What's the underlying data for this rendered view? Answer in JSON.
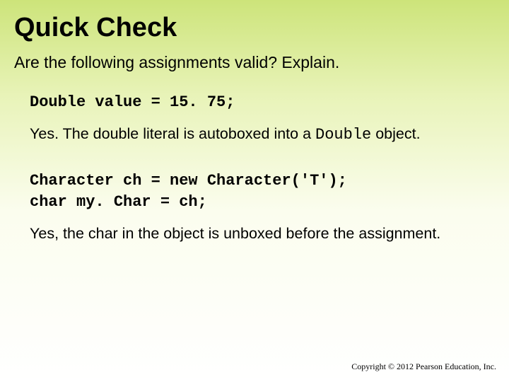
{
  "title": "Quick Check",
  "question": "Are the following assignments valid? Explain.",
  "block1": {
    "code": "Double value = 15. 75;",
    "answer_pre": "Yes. The double literal is autoboxed into a ",
    "answer_mono": "Double",
    "answer_post": " object."
  },
  "block2": {
    "code1": "Character ch = new Character('T');",
    "code2": "char my. Char = ch;",
    "answer": "Yes, the char in the object is unboxed before the assignment."
  },
  "copyright": "Copyright © 2012 Pearson Education, Inc."
}
